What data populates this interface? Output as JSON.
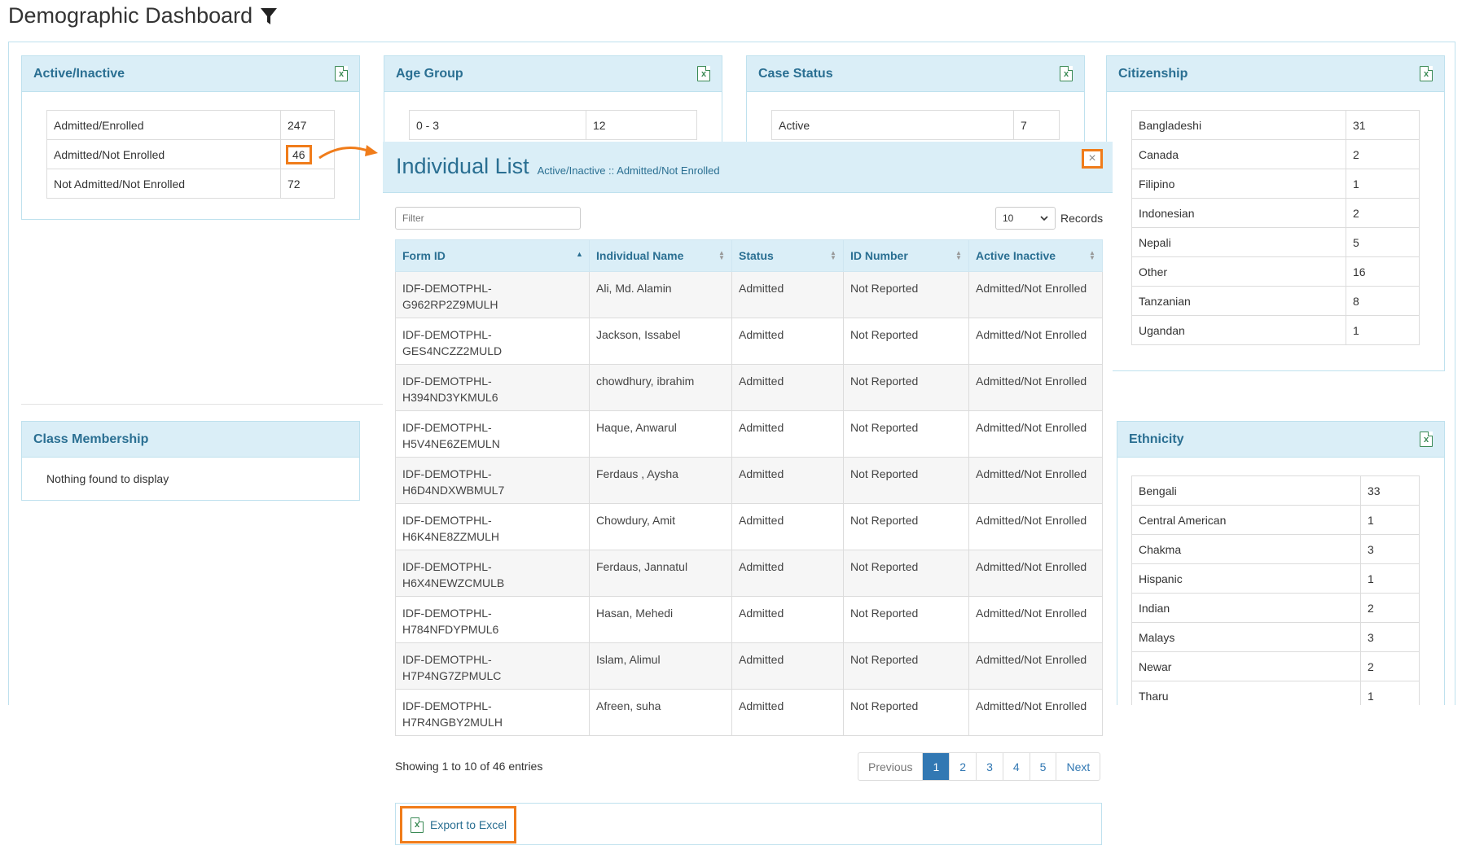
{
  "page": {
    "title": "Demographic Dashboard"
  },
  "active_inactive": {
    "title": "Active/Inactive",
    "rows": [
      {
        "label": "Admitted/Enrolled",
        "value": "247"
      },
      {
        "label": "Admitted/Not Enrolled",
        "value": "46"
      },
      {
        "label": "Not Admitted/Not Enrolled",
        "value": "72"
      }
    ]
  },
  "age_group": {
    "title": "Age Group",
    "rows": [
      {
        "label": "0 - 3",
        "value": "12"
      }
    ]
  },
  "case_status": {
    "title": "Case Status",
    "rows": [
      {
        "label": "Active",
        "value": "7"
      }
    ]
  },
  "citizenship": {
    "title": "Citizenship",
    "rows": [
      {
        "label": "Bangladeshi",
        "value": "31"
      },
      {
        "label": "Canada",
        "value": "2"
      },
      {
        "label": "Filipino",
        "value": "1"
      },
      {
        "label": "Indonesian",
        "value": "2"
      },
      {
        "label": "Nepali",
        "value": "5"
      },
      {
        "label": "Other",
        "value": "16"
      },
      {
        "label": "Tanzanian",
        "value": "8"
      },
      {
        "label": "Ugandan",
        "value": "1"
      }
    ]
  },
  "class_membership": {
    "title": "Class Membership",
    "empty_text": "Nothing found to display"
  },
  "ethnicity": {
    "title": "Ethnicity",
    "rows": [
      {
        "label": "Bengali",
        "value": "33"
      },
      {
        "label": "Central American",
        "value": "1"
      },
      {
        "label": "Chakma",
        "value": "3"
      },
      {
        "label": "Hispanic",
        "value": "1"
      },
      {
        "label": "Indian",
        "value": "2"
      },
      {
        "label": "Malays",
        "value": "3"
      },
      {
        "label": "Newar",
        "value": "2"
      },
      {
        "label": "Tharu",
        "value": "1"
      }
    ]
  },
  "modal": {
    "title": "Individual List",
    "subtitle": "Active/Inactive :: Admitted/Not Enrolled",
    "close_glyph": "×",
    "filter_placeholder": "Filter",
    "page_size": "10",
    "records_label": "Records",
    "columns": [
      "Form ID",
      "Individual Name",
      "Status",
      "ID Number",
      "Active Inactive"
    ],
    "rows": [
      {
        "form_id_1": "IDF-DEMOTPHL-",
        "form_id_2": "G962RP2Z9MULH",
        "name": "Ali, Md. Alamin",
        "status": "Admitted",
        "id_number": "Not Reported",
        "active_inactive": "Admitted/Not Enrolled"
      },
      {
        "form_id_1": "IDF-DEMOTPHL-",
        "form_id_2": "GES4NCZZ2MULD",
        "name": "Jackson, Issabel",
        "status": "Admitted",
        "id_number": "Not Reported",
        "active_inactive": "Admitted/Not Enrolled"
      },
      {
        "form_id_1": "IDF-DEMOTPHL-",
        "form_id_2": "H394ND3YKMUL6",
        "name": "chowdhury, ibrahim",
        "status": "Admitted",
        "id_number": "Not Reported",
        "active_inactive": "Admitted/Not Enrolled"
      },
      {
        "form_id_1": "IDF-DEMOTPHL-",
        "form_id_2": "H5V4NE6ZEMULN",
        "name": "Haque, Anwarul",
        "status": "Admitted",
        "id_number": "Not Reported",
        "active_inactive": "Admitted/Not Enrolled"
      },
      {
        "form_id_1": "IDF-DEMOTPHL-",
        "form_id_2": "H6D4NDXWBMUL7",
        "name": "Ferdaus , Aysha",
        "status": "Admitted",
        "id_number": "Not Reported",
        "active_inactive": "Admitted/Not Enrolled"
      },
      {
        "form_id_1": "IDF-DEMOTPHL-",
        "form_id_2": "H6K4NE8ZZMULH",
        "name": "Chowdury, Amit",
        "status": "Admitted",
        "id_number": "Not Reported",
        "active_inactive": "Admitted/Not Enrolled"
      },
      {
        "form_id_1": "IDF-DEMOTPHL-",
        "form_id_2": "H6X4NEWZCMULB",
        "name": "Ferdaus, Jannatul",
        "status": "Admitted",
        "id_number": "Not Reported",
        "active_inactive": "Admitted/Not Enrolled"
      },
      {
        "form_id_1": "IDF-DEMOTPHL-",
        "form_id_2": "H784NFDYPMUL6",
        "name": "Hasan, Mehedi",
        "status": "Admitted",
        "id_number": "Not Reported",
        "active_inactive": "Admitted/Not Enrolled"
      },
      {
        "form_id_1": "IDF-DEMOTPHL-",
        "form_id_2": "H7P4NG7ZPMULC",
        "name": "Islam, Alimul",
        "status": "Admitted",
        "id_number": "Not Reported",
        "active_inactive": "Admitted/Not Enrolled"
      },
      {
        "form_id_1": "IDF-DEMOTPHL-",
        "form_id_2": "H7R4NGBY2MULH",
        "name": "Afreen, suha",
        "status": "Admitted",
        "id_number": "Not Reported",
        "active_inactive": "Admitted/Not Enrolled"
      }
    ],
    "info_text": "Showing 1 to 10 of 46 entries",
    "pager": {
      "previous": "Previous",
      "pages": [
        "1",
        "2",
        "3",
        "4",
        "5"
      ],
      "next": "Next"
    },
    "export_label": "Export to Excel"
  },
  "colors": {
    "accent": "#2a6f92",
    "header_bg": "#daeef7",
    "highlight": "#f07c1a",
    "active_page": "#3278b3"
  }
}
